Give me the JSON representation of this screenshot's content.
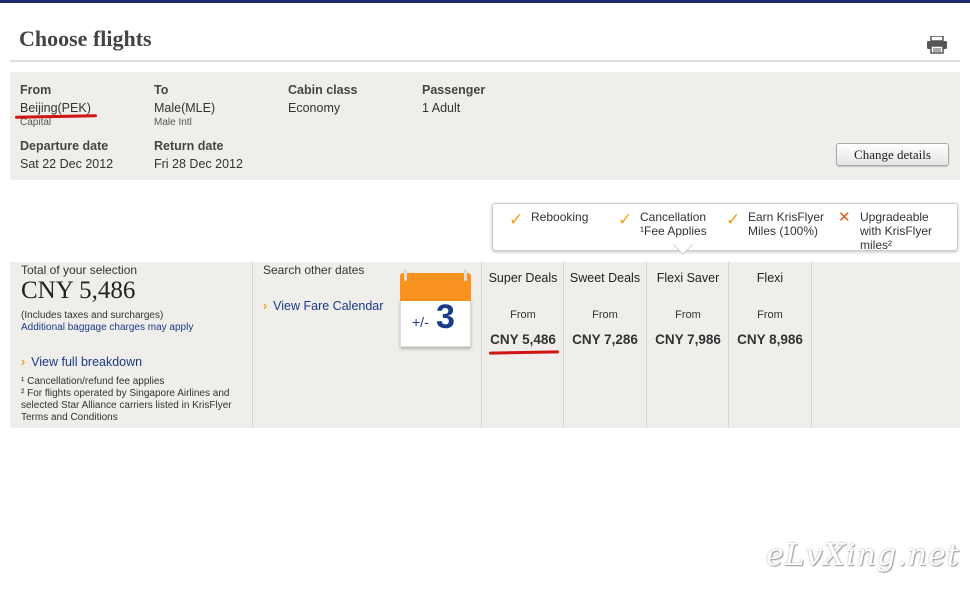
{
  "page": {
    "title": "Choose flights"
  },
  "summary": {
    "from": {
      "label": "From",
      "value": "Beijing(PEK)",
      "sub": "Capital"
    },
    "to": {
      "label": "To",
      "value": "Male(MLE)",
      "sub": "Male Intl"
    },
    "cabin": {
      "label": "Cabin class",
      "value": "Economy"
    },
    "passenger": {
      "label": "Passenger",
      "value": "1 Adult"
    },
    "departure": {
      "label": "Departure date",
      "value": "Sat 22 Dec 2012"
    },
    "return": {
      "label": "Return date",
      "value": "Fri 28 Dec 2012"
    },
    "change_label": "Change details"
  },
  "features": [
    {
      "mark": "check",
      "line1": "Rebooking",
      "line2": ""
    },
    {
      "mark": "check",
      "line1": "Cancellation",
      "line2": "¹Fee Applies"
    },
    {
      "mark": "check",
      "line1": "Earn KrisFlyer",
      "line2": "Miles (100%)"
    },
    {
      "mark": "cross",
      "line1": "Upgradeable",
      "line2": "with KrisFlyer",
      "line3": "miles²"
    }
  ],
  "selection": {
    "total_label": "Total of your selection",
    "total_price": "CNY 5,486",
    "taxes_note": "(Includes taxes and surcharges)",
    "baggage_note": "Additional baggage charges may apply",
    "breakdown_link": "View full breakdown",
    "footnote1": "¹ Cancellation/refund fee applies",
    "footnote2a": "² For flights operated by Singapore Airlines and",
    "footnote2b": "selected Star Alliance carriers listed in KrisFlyer",
    "footnote2c": "Terms and Conditions"
  },
  "other_dates": {
    "label": "Search other dates",
    "calendar_link": "View Fare Calendar",
    "calendar_prefix": "+/-",
    "calendar_days": "3"
  },
  "fares": [
    {
      "name": "Super Deals",
      "from": "From",
      "price": "CNY 5,486"
    },
    {
      "name": "Sweet Deals",
      "from": "From",
      "price": "CNY 7,286"
    },
    {
      "name": "Flexi Saver",
      "from": "From",
      "price": "CNY 7,986"
    },
    {
      "name": "Flexi",
      "from": "From",
      "price": "CNY 8,986"
    }
  ],
  "watermark": "eLvXing.net",
  "colors": {
    "accent": "#f0a020",
    "link": "#1a3a8a",
    "annotation": "#d01414",
    "panel": "#efeeea"
  },
  "icons": {
    "print": "printer-icon",
    "calendar": "calendar-icon",
    "check": "check-icon",
    "cross": "cross-icon",
    "chevron": "chevron-right-icon"
  }
}
